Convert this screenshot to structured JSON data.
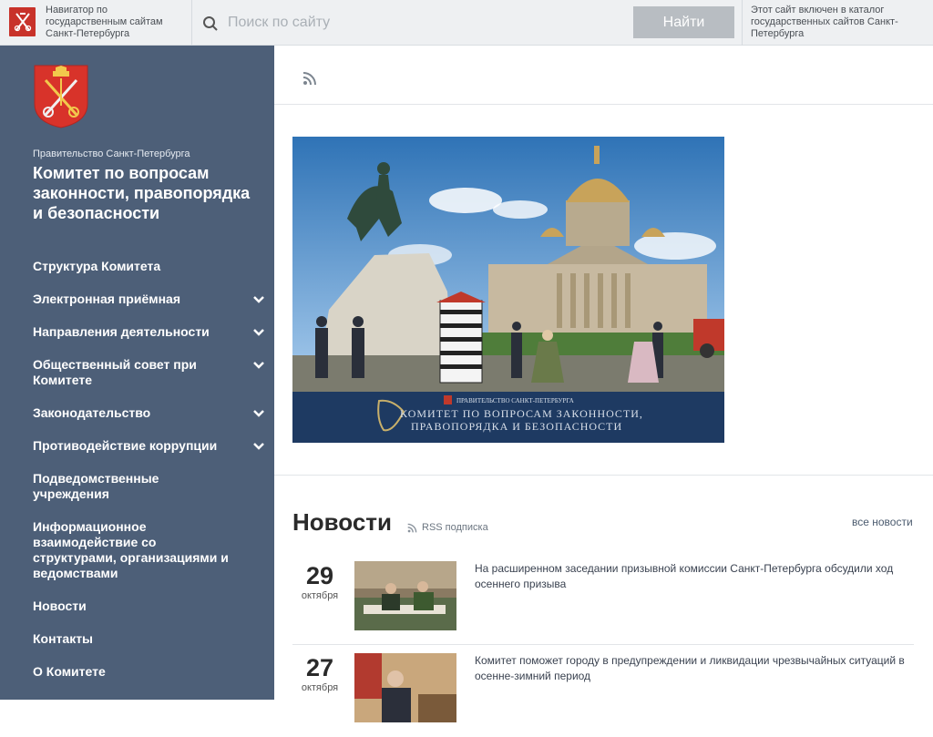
{
  "topbar": {
    "navigator_text": "Навигатор по государственным сайтам Санкт-Петербурга",
    "search_placeholder": "Поиск по сайту",
    "search_button": "Найти",
    "catalog_text": "Этот сайт включен в каталог государственных сайтов Санкт-Петербурга"
  },
  "sidebar": {
    "gov_label": "Правительство Санкт-Петербурга",
    "committee_title": "Комитет по вопросам законности, правопорядка и безопасности",
    "items": [
      {
        "label": "Структура Комитета",
        "expandable": false
      },
      {
        "label": "Электронная приёмная",
        "expandable": true
      },
      {
        "label": "Направления деятельности",
        "expandable": true
      },
      {
        "label": "Общественный совет при Комитете",
        "expandable": true
      },
      {
        "label": "Законодательство",
        "expandable": true
      },
      {
        "label": "Противодействие коррупции",
        "expandable": true
      },
      {
        "label": "Подведомственные учреждения",
        "expandable": false
      },
      {
        "label": "Информационное взаимодействие со структурами, организациями и ведомствами",
        "expandable": false
      },
      {
        "label": "Новости",
        "expandable": false
      },
      {
        "label": "Контакты",
        "expandable": false
      },
      {
        "label": "О Комитете",
        "expandable": false
      }
    ]
  },
  "banner": {
    "small_caption": "ПРАВИТЕЛЬСТВО САНКТ-ПЕТЕРБУРГА",
    "line1": "КОМИТЕТ ПО ВОПРОСАМ ЗАКОННОСТИ,",
    "line2": "ПРАВОПОРЯДКА И БЕЗОПАСНОСТИ"
  },
  "news": {
    "title": "Новости",
    "rss_label": "RSS подписка",
    "all_label": "все новости",
    "items": [
      {
        "day": "29",
        "month": "октября",
        "text": "На расширенном заседании призывной комиссии Санкт-Петербурга обсудили ход осеннего призыва"
      },
      {
        "day": "27",
        "month": "октября",
        "text": "Комитет поможет городу в предупреждении и ликвидации чрезвычайных ситуаций в осенне-зимний период"
      }
    ]
  },
  "colors": {
    "sidebar_bg": "#4d5f78",
    "topbar_bg": "#eef0f2",
    "button_bg": "#b8bdc2",
    "logo_red": "#c8322a"
  },
  "icons": [
    "coat-of-arms-icon",
    "search-icon",
    "rss-icon",
    "chevron-down-icon"
  ]
}
